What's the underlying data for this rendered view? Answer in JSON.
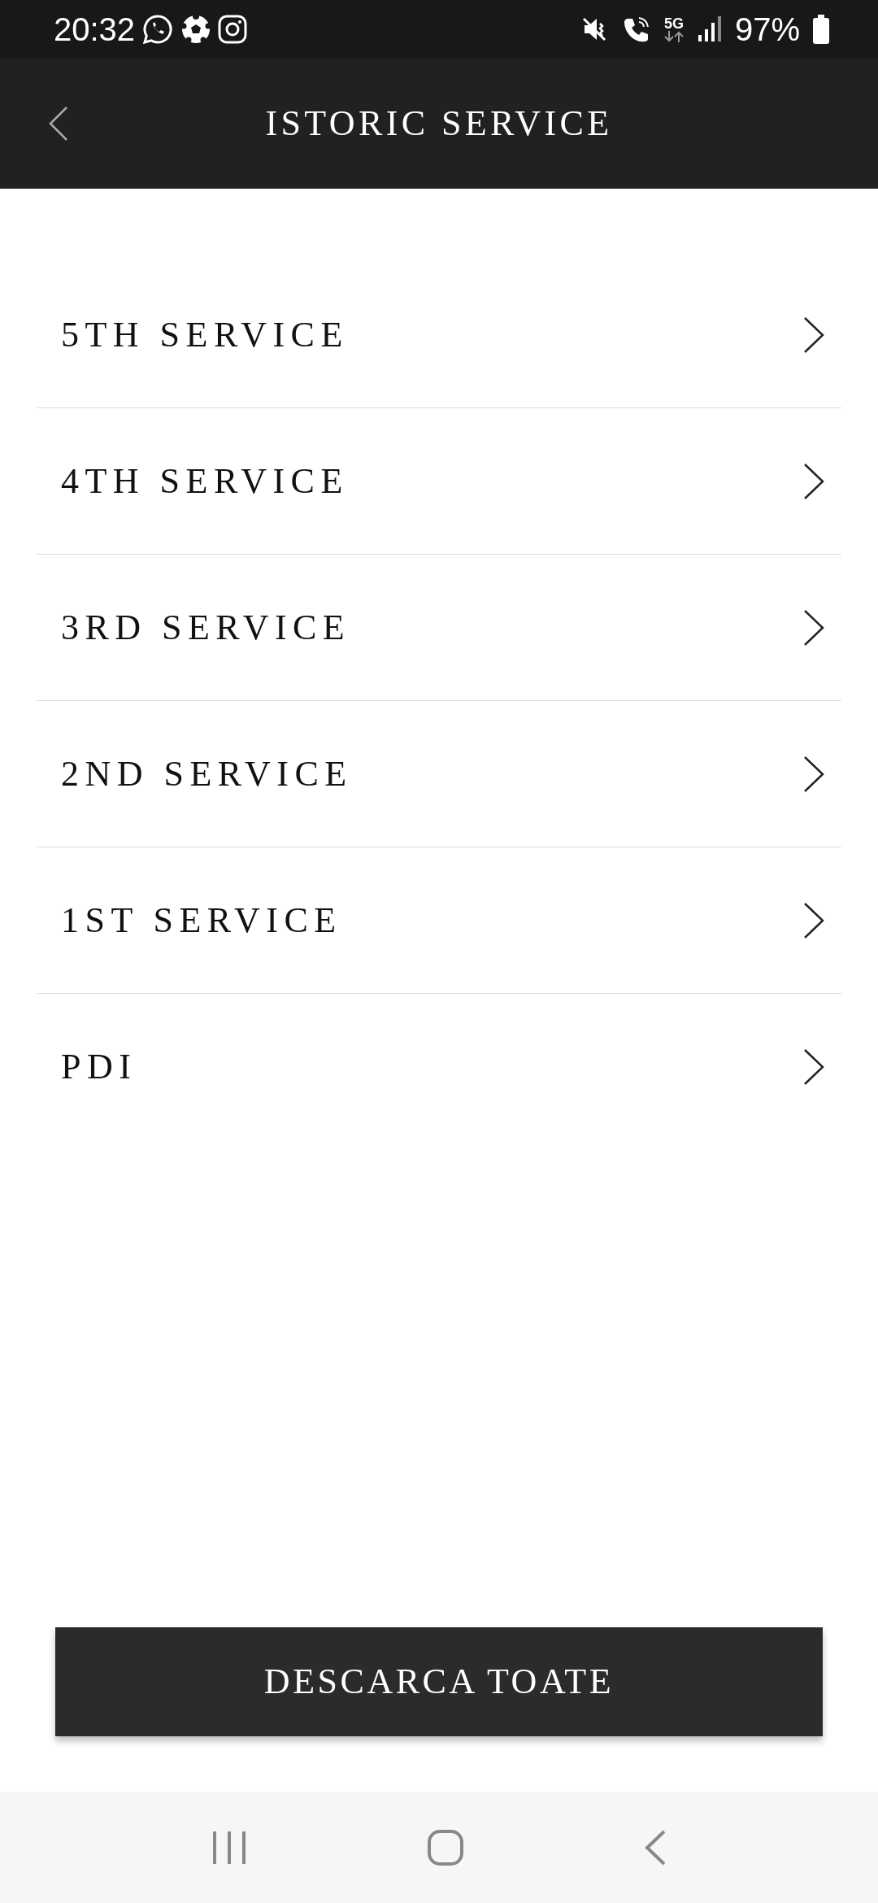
{
  "status_bar": {
    "time": "20:32",
    "network": "5G",
    "battery": "97%"
  },
  "header": {
    "title": "ISTORIC SERVICE"
  },
  "services": [
    {
      "label": "5TH SERVICE"
    },
    {
      "label": "4TH SERVICE"
    },
    {
      "label": "3RD SERVICE"
    },
    {
      "label": "2ND SERVICE"
    },
    {
      "label": "1ST SERVICE"
    },
    {
      "label": "PDI"
    }
  ],
  "download_button": {
    "label": "DESCARCA TOATE"
  }
}
